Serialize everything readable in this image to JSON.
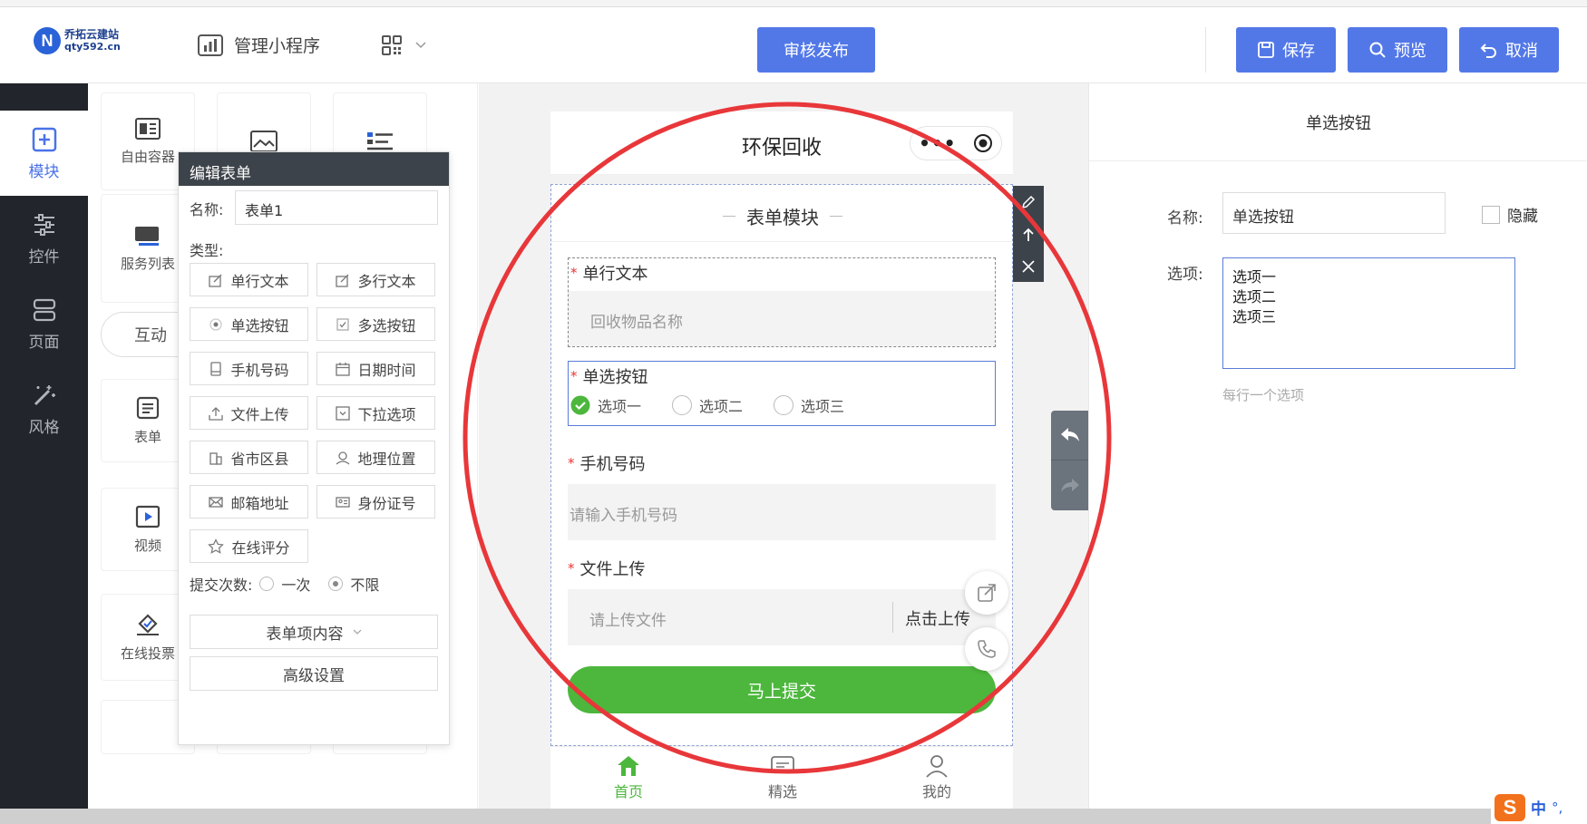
{
  "topbar": {
    "logo_name": "乔拓云建站",
    "logo_domain": "qty592.cn",
    "manage_label": "管理小程序",
    "publish_label": "审核发布",
    "save_label": "保存",
    "preview_label": "预览",
    "cancel_label": "取消"
  },
  "leftnav": {
    "items": [
      {
        "label": "模块",
        "icon": "plus-square-icon"
      },
      {
        "label": "控件",
        "icon": "sliders-icon"
      },
      {
        "label": "页面",
        "icon": "layers-icon"
      },
      {
        "label": "风格",
        "icon": "magic-wand-icon"
      }
    ]
  },
  "modules": {
    "tiles": [
      "自由容器",
      "服务列表",
      "互动",
      "表单",
      "视频",
      "在线投票"
    ]
  },
  "edit_form": {
    "title": "编辑表单",
    "name_label": "名称:",
    "name_value": "表单1",
    "type_label": "类型:",
    "types": [
      "单行文本",
      "多行文本",
      "单选按钮",
      "多选按钮",
      "手机号码",
      "日期时间",
      "文件上传",
      "下拉选项",
      "省市区县",
      "地理位置",
      "邮箱地址",
      "身份证号",
      "在线评分"
    ],
    "submit_label": "提交次数:",
    "submit_once": "一次",
    "submit_unlimited": "不限",
    "content_button": "表单项内容",
    "advanced_button": "高级设置"
  },
  "phone": {
    "title": "环保回收",
    "section_title": "表单模块",
    "field1_label": "单行文本",
    "field1_placeholder": "回收物品名称",
    "field2_label": "单选按钮",
    "options": [
      "选项一",
      "选项二",
      "选项三"
    ],
    "field3_label": "手机号码",
    "field3_placeholder": "请输入手机号码",
    "field4_label": "文件上传",
    "field4_placeholder": "请上传文件",
    "field4_button": "点击上传",
    "submit_button": "马上提交",
    "tabs": [
      "首页",
      "精选",
      "我的"
    ]
  },
  "right_panel": {
    "title": "单选按钮",
    "name_label": "名称:",
    "name_value": "单选按钮",
    "hide_label": "隐藏",
    "options_label": "选项:",
    "options_value": "选项一\n选项二\n选项三",
    "hint": "每行一个选项"
  },
  "ime": {
    "label": "中",
    "punct": "°,"
  },
  "colors": {
    "accent": "#5278e8",
    "green": "#4cb73c",
    "annotation_red": "#e8373a",
    "nav_dark": "#22252b"
  }
}
